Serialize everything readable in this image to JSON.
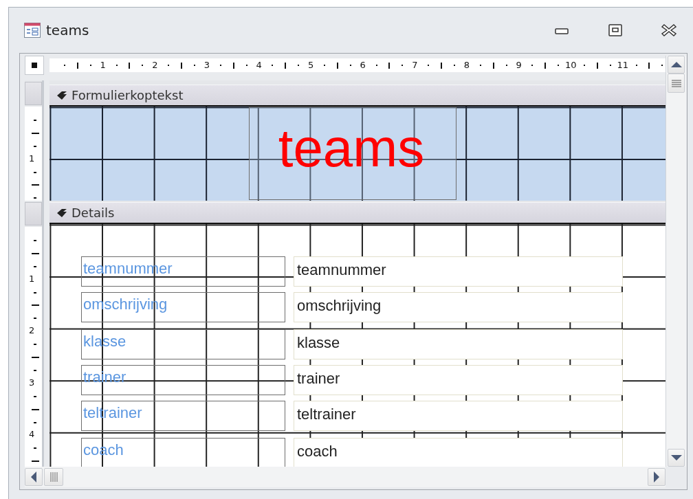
{
  "window": {
    "title": "teams"
  },
  "ruler": {
    "horizontal_marks": [
      "1",
      "2",
      "3",
      "4",
      "5",
      "6",
      "7",
      "8",
      "9",
      "10",
      "11"
    ]
  },
  "form_header": {
    "title": "Formulierkoptekst",
    "ruler_marks": [
      "1"
    ],
    "title_label": "teams"
  },
  "details": {
    "title": "Details",
    "ruler_marks": [
      "1",
      "2",
      "3",
      "4"
    ],
    "rows": [
      {
        "label": "teamnummer",
        "field": "teamnummer"
      },
      {
        "label": "omschrijving",
        "field": "omschrijving"
      },
      {
        "label": "klasse",
        "field": "klasse"
      },
      {
        "label": "trainer",
        "field": "trainer"
      },
      {
        "label": "teltrainer",
        "field": "teltrainer"
      },
      {
        "label": "coach",
        "field": "coach"
      }
    ]
  }
}
